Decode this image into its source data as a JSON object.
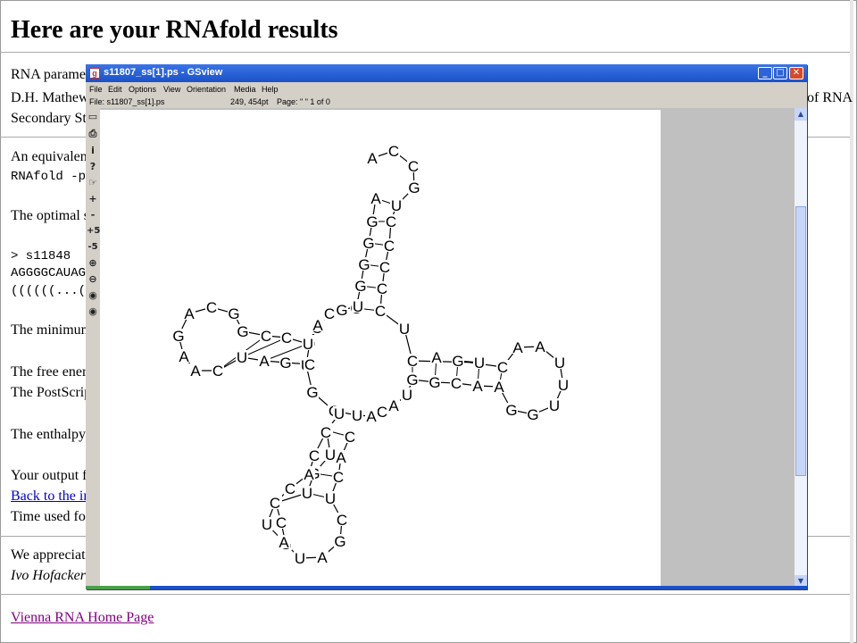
{
  "web": {
    "title": "Here are your RNAfold results",
    "lines": {
      "params1": "RNA paramet",
      "params2": "D.H. Mathew",
      "params2_tail": "of RNA",
      "params3": "Secondary St",
      "equiv": "An equivalent",
      "cmd": "RNAfold -p",
      "optimal": "The optimal s",
      "seqname": "> s11848",
      "sequence": "AGGGGCAUAG",
      "structure": "((((((...(",
      "minimum": "The minimum",
      "free_energy": "The free energ",
      "postscript": "The PostScrip",
      "enthalpy": "The enthalpy",
      "output": "Your output fi",
      "back_link": "Back to the in",
      "time_used": "Time used for",
      "appreciate": "We appreciat",
      "author": "Ivo Hofacker",
      "home_link": "Vienna RNA Home Page"
    }
  },
  "gsview": {
    "window_title": "s11807_ss[1].ps - GSview",
    "menu": [
      "File",
      "Edit",
      "Options",
      "View",
      "Orientation",
      "Media",
      "Help"
    ],
    "status": {
      "file": "File: s11807_ss[1].ps",
      "coords": "249, 454pt",
      "page": "Page: \" \"  1 of 0"
    },
    "toolbar": [
      "+",
      "-",
      "+5",
      "-5"
    ],
    "controls": {
      "minimize": "_",
      "maximize": "□",
      "close": "✕"
    }
  },
  "structure": {
    "nucleotides": [
      {
        "base": "A"
      },
      {
        "base": "C"
      },
      {
        "base": "C"
      },
      {
        "base": "G"
      },
      {
        "base": "A"
      },
      {
        "base": "U"
      },
      {
        "base": "G"
      },
      {
        "base": "C"
      },
      {
        "base": "G"
      },
      {
        "base": "C"
      },
      {
        "base": "G"
      },
      {
        "base": "C"
      },
      {
        "base": "G"
      },
      {
        "base": "C"
      },
      {
        "base": "G"
      },
      {
        "base": "C"
      },
      {
        "base": "U"
      },
      {
        "base": "A"
      },
      {
        "base": "C"
      },
      {
        "base": "G"
      },
      {
        "base": "U"
      },
      {
        "base": "C"
      },
      {
        "base": "A"
      },
      {
        "base": "A"
      },
      {
        "base": "U"
      },
      {
        "base": "U"
      },
      {
        "base": "U"
      },
      {
        "base": "G"
      },
      {
        "base": "G"
      },
      {
        "base": "A"
      },
      {
        "base": "A"
      },
      {
        "base": "C"
      },
      {
        "base": "G"
      },
      {
        "base": "G"
      },
      {
        "base": "U"
      },
      {
        "base": "A"
      },
      {
        "base": "C"
      },
      {
        "base": "A"
      },
      {
        "base": "U"
      },
      {
        "base": "C"
      },
      {
        "base": "G"
      },
      {
        "base": "U"
      },
      {
        "base": "G"
      },
      {
        "base": "C"
      },
      {
        "base": "C"
      },
      {
        "base": "G"
      },
      {
        "base": "U"
      },
      {
        "base": "U"
      },
      {
        "base": "C"
      },
      {
        "base": "U"
      },
      {
        "base": "A"
      },
      {
        "base": "G"
      },
      {
        "base": "C"
      },
      {
        "base": "U"
      },
      {
        "base": "U"
      },
      {
        "base": "A"
      },
      {
        "base": "C"
      },
      {
        "base": "C"
      },
      {
        "base": "G"
      },
      {
        "base": "G"
      },
      {
        "base": "U"
      },
      {
        "base": "A"
      },
      {
        "base": "A"
      },
      {
        "base": "U"
      },
      {
        "base": "C"
      },
      {
        "base": "C"
      },
      {
        "base": "A"
      },
      {
        "base": "C"
      },
      {
        "base": "C"
      },
      {
        "base": "U"
      },
      {
        "base": "C"
      },
      {
        "base": "G"
      },
      {
        "base": "A"
      },
      {
        "base": "U"
      },
      {
        "base": "C"
      },
      {
        "base": "A"
      },
      {
        "base": "A"
      },
      {
        "base": "G"
      },
      {
        "base": "A"
      },
      {
        "base": "C"
      },
      {
        "base": "G"
      },
      {
        "base": "G"
      },
      {
        "base": "C"
      },
      {
        "base": "C"
      },
      {
        "base": "U"
      },
      {
        "base": "A"
      }
    ]
  }
}
